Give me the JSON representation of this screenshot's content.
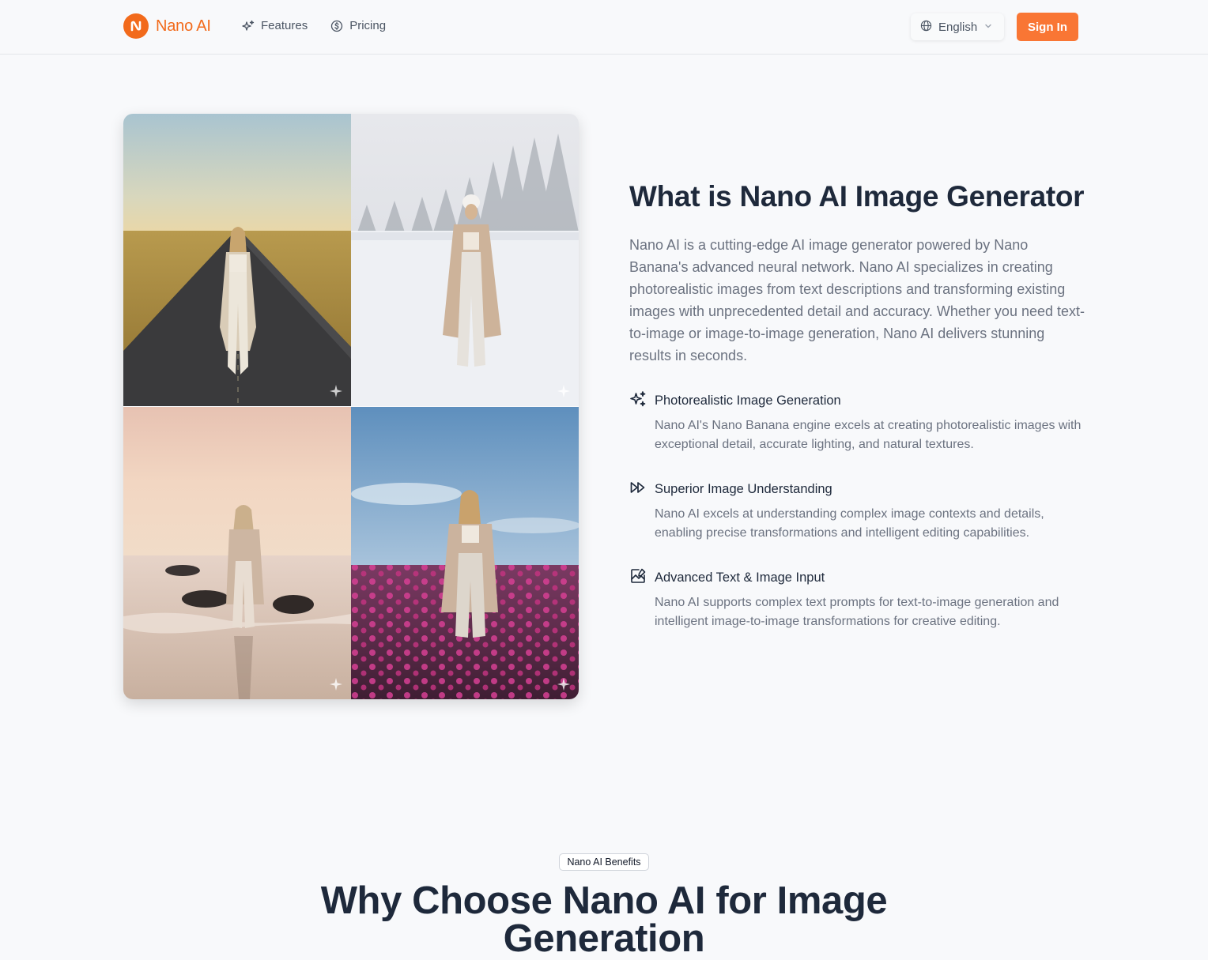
{
  "header": {
    "brand_name": "Nano AI",
    "nav": [
      {
        "label": "Features",
        "icon": "sparkles-icon"
      },
      {
        "label": "Pricing",
        "icon": "dollar-circle-icon"
      }
    ],
    "language": "English",
    "signin_label": "Sign In"
  },
  "about": {
    "title": "What is Nano AI Image Generator",
    "description": "Nano AI is a cutting-edge AI image generator powered by Nano Banana's advanced neural network. Nano AI specializes in creating photorealistic images from text descriptions and transforming existing images with unprecedented detail and accuracy. Whether you need text-to-image or image-to-image generation, Nano AI delivers stunning results in seconds.",
    "features": [
      {
        "icon": "sparkles-icon",
        "title": "Photorealistic Image Generation",
        "description": "Nano AI's Nano Banana engine excels at creating photorealistic images with exceptional detail, accurate lighting, and natural textures."
      },
      {
        "icon": "fast-forward-icon",
        "title": "Superior Image Understanding",
        "description": "Nano AI excels at understanding complex image contexts and details, enabling precise transformations and intelligent editing capabilities."
      },
      {
        "icon": "image-edit-icon",
        "title": "Advanced Text & Image Input",
        "description": "Nano AI supports complex text prompts for text-to-image generation and intelligent image-to-image transformations for creative editing."
      }
    ]
  },
  "gallery": [
    {
      "scene": "road-field"
    },
    {
      "scene": "snow-forest"
    },
    {
      "scene": "beach-sunset"
    },
    {
      "scene": "flower-field"
    }
  ],
  "benefits": {
    "badge": "Nano AI Benefits",
    "title": "Why Choose Nano AI for Image Generation"
  },
  "colors": {
    "brand": "#f26a1b",
    "signin_bg": "#f97634",
    "heading": "#1e293b",
    "muted": "#6b7280"
  }
}
